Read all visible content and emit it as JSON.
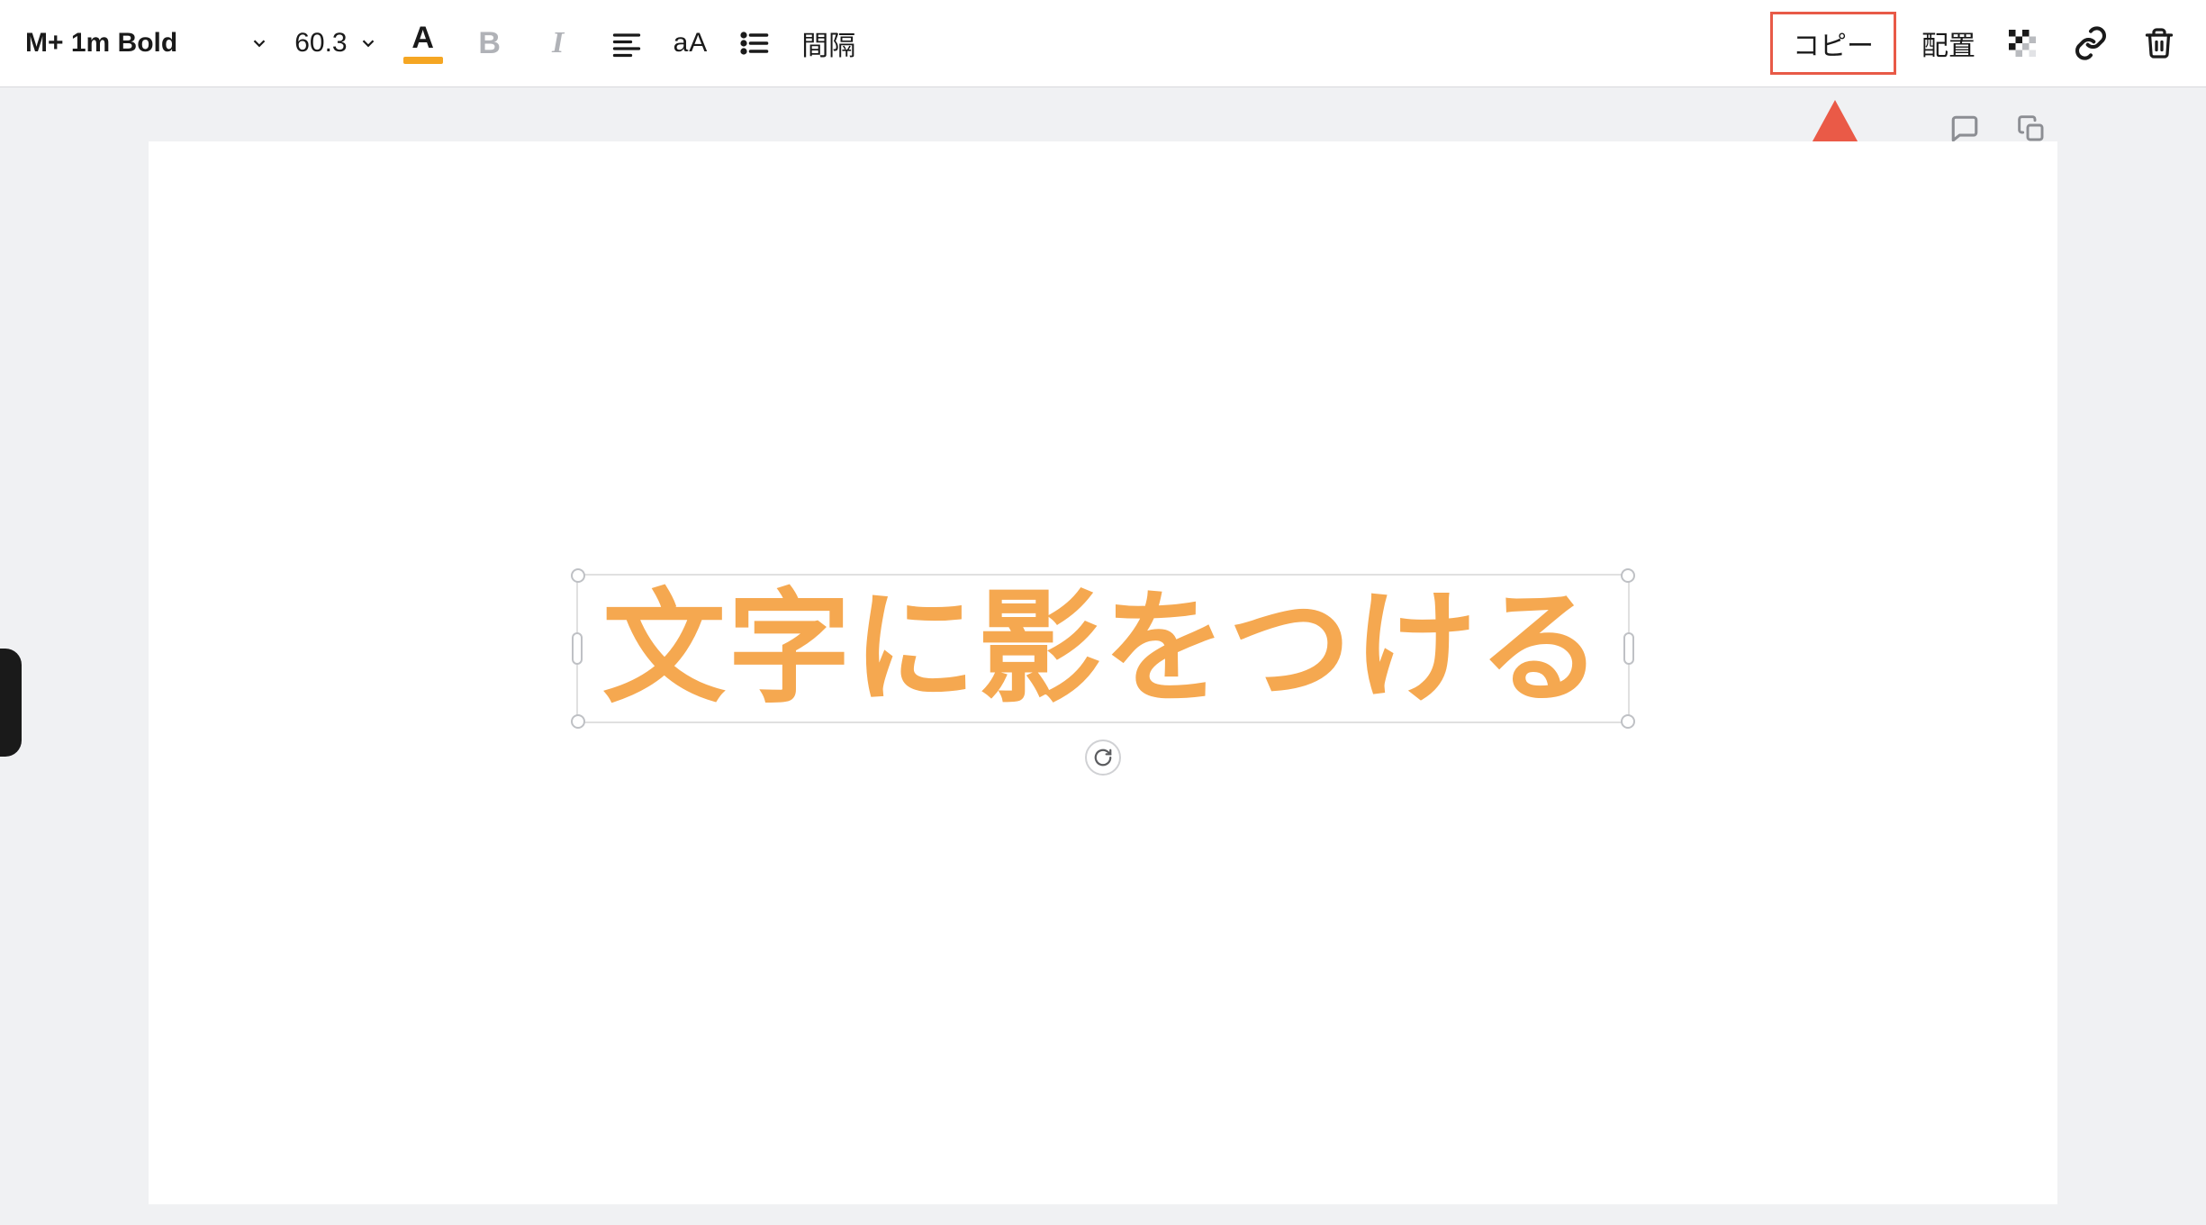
{
  "toolbar": {
    "font_family": "M+ 1m Bold",
    "font_size": "60.3",
    "text_color_accent": "#f5a623",
    "case_label": "aA",
    "spacing_label": "間隔",
    "copy_label": "コピー",
    "arrange_label": "配置"
  },
  "canvas": {
    "text_value": "文字に影をつける",
    "text_color": "#f5a850"
  }
}
